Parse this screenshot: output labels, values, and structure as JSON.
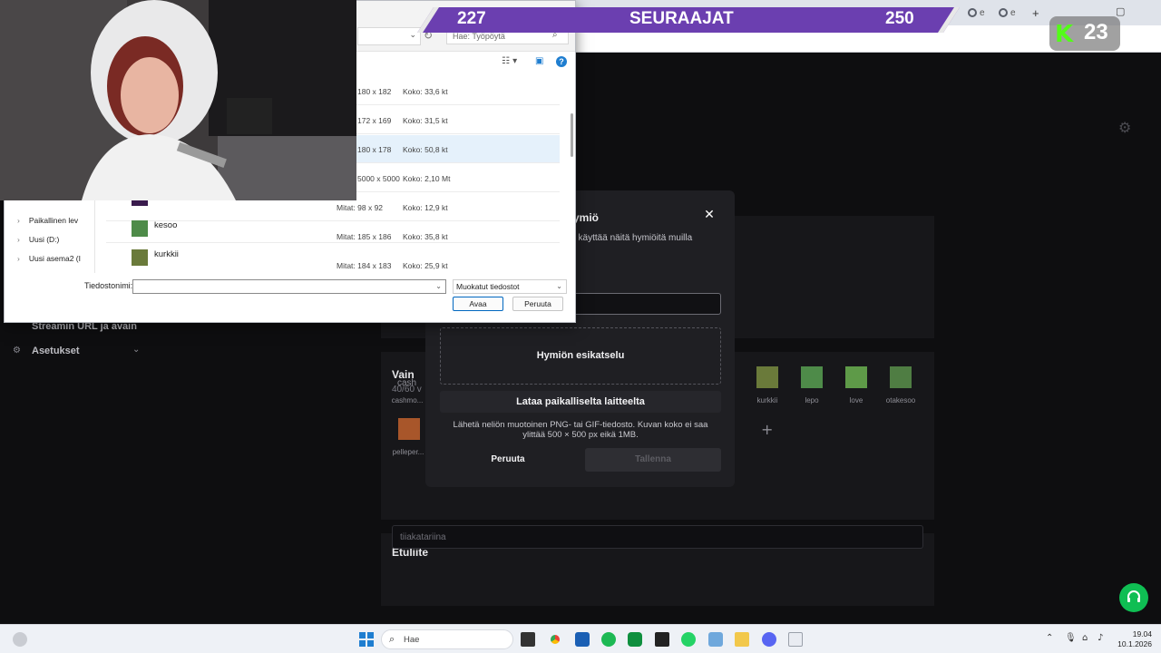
{
  "browser": {
    "tab_fragments": [
      "e",
      "e"
    ],
    "new_tab": "+",
    "minimize": "−",
    "maximize": "▢",
    "kebab": "⋮"
  },
  "stream_overlay": {
    "followers_current": "227",
    "followers_label": "SEURAAJAT",
    "followers_goal": "250",
    "viewer_count": "23",
    "viewer_logo": "K"
  },
  "sidebar": {
    "stream_url_label": "Streamin URL ja avain",
    "settings_label": "Asetukset"
  },
  "emotes_section": {
    "title_fragment": "Vain",
    "count_fragment": "40/60 v",
    "items": [
      {
        "label": "cashmo...",
        "alt": "cash"
      },
      {
        "label": "pelleper..."
      },
      {
        "label": "kurkkii"
      },
      {
        "label": "lepo"
      },
      {
        "label": "love"
      },
      {
        "label": "otakesoo"
      }
    ],
    "add_icon": "+"
  },
  "prefix_section": {
    "title": "Etuliite",
    "value": "tiiakatariina"
  },
  "modal": {
    "title_fragment": "ymiö",
    "desc_fragment": "t käyttää näitä hymiöitä muilla",
    "preview_label": "Hymiön esikatselu",
    "upload_label": "Lataa paikalliselta laitteelta",
    "help_text": "Lähetä neliön muotoinen PNG- tai GIF-tiedosto. Kuvan koko ei saa ylittää 500 × 500 px eikä 1MB.",
    "cancel_label": "Peruuta",
    "save_label": "Tallenna"
  },
  "file_dialog": {
    "search_placeholder": "Hae: Työpöytä",
    "rows": [
      {
        "name": "",
        "dims": "180 x 182",
        "size": "Koko: 33,6 kt"
      },
      {
        "name": "",
        "dims": "172 x 169",
        "size": "Koko: 31,5 kt"
      },
      {
        "name": "",
        "dims": "180 x 178",
        "size": "Koko: 50,8 kt"
      },
      {
        "name": "",
        "dims": "5000 x 5000",
        "size": "Koko: 2,10 Mt"
      },
      {
        "name": "",
        "dims": "Mitat: 98 x 92",
        "size": "Koko: 12,9 kt"
      },
      {
        "name": "kesoo",
        "dims": "Mitat: 185 x 186",
        "size": "Koko: 35,8 kt"
      },
      {
        "name": "kurkkii",
        "dims": "Mitat: 184 x 183",
        "size": "Koko: 25,9 kt"
      }
    ],
    "nav": [
      {
        "label": "Paikallinen lev"
      },
      {
        "label": "Uusi (D:)"
      },
      {
        "label": "Uusi asema2 (I"
      }
    ],
    "filename_label": "Tiedostonimi:",
    "filetype": "Muokatut tiedostot",
    "open_label": "Avaa",
    "cancel_label": "Peruuta"
  },
  "taskbar": {
    "search_placeholder": "Hae",
    "time": "19.04",
    "date": "10.1.2026"
  },
  "colors": {
    "accent_green": "#53fc18",
    "banner_purple": "#6b3fb0",
    "help_green": "#0fbe53"
  }
}
